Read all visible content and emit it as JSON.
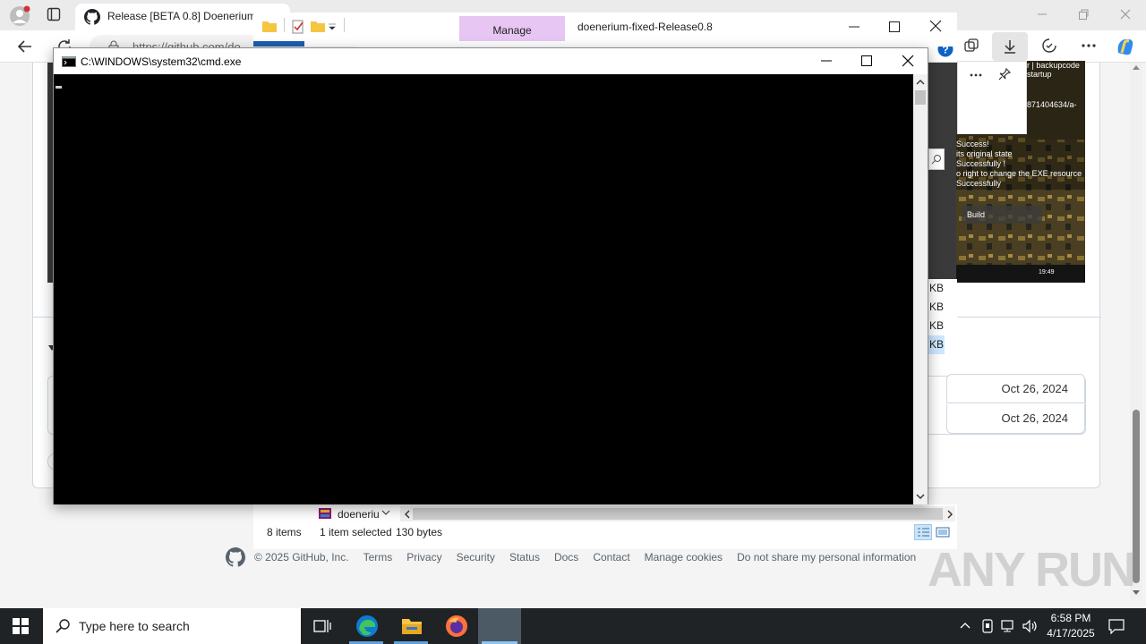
{
  "browser": {
    "tab_title": "Release [BETA 0.8] Doenerium -",
    "address": "https://github.com/do",
    "github_footer": {
      "copyright": "© 2025 GitHub, Inc.",
      "links": [
        "Terms",
        "Privacy",
        "Security",
        "Status",
        "Docs",
        "Contact",
        "Manage cookies",
        "Do not share my personal information"
      ]
    },
    "asset_dates": [
      "Oct 26, 2024",
      "Oct 26, 2024"
    ],
    "video_text": [
      "r | backupcode",
      "startup",
      "871404634/a-",
      "Success!",
      "its original state",
      "Successfully !",
      "o right to change the EXE resource",
      "Successfully",
      "Build",
      "19:49"
    ]
  },
  "explorer": {
    "manage_tab": "Manage",
    "folder_name": "doenerium-fixed-Release0.8",
    "file_partial": "doeneriu",
    "size_units": [
      "KB",
      "KB",
      "KB",
      "KB"
    ],
    "status": {
      "item_count": "8 items",
      "selected": "1 item selected",
      "size": "130 bytes"
    }
  },
  "cmd": {
    "title": "C:\\WINDOWS\\system32\\cmd.exe"
  },
  "taskbar": {
    "search_placeholder": "Type here to search",
    "time": "6:58 PM",
    "date": "4/17/2025"
  },
  "watermark": "ANY RUN"
}
